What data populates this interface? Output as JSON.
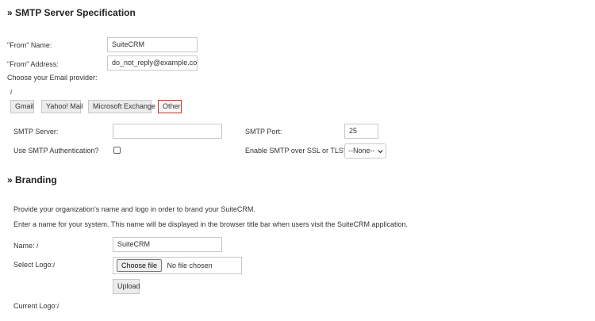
{
  "smtp": {
    "heading": "» SMTP Server Specification",
    "from_name_label": "\"From\" Name:",
    "from_name_value": "SuiteCRM",
    "from_address_label": "\"From\" Address:",
    "from_address_value": "do_not_reply@example.com",
    "provider_label": "Choose your Email provider:",
    "provider_info": "i",
    "providers": [
      "Gmail",
      "Yahoo! Mail",
      "Microsoft Exchange",
      "Other"
    ],
    "selected_provider": "Other",
    "server_label": "SMTP Server:",
    "server_value": "",
    "port_label": "SMTP Port:",
    "port_value": "25",
    "auth_label": "Use SMTP Authentication?",
    "ssl_label": "Enable SMTP over SSL or TLS?",
    "ssl_value": "--None--"
  },
  "branding": {
    "heading": "» Branding",
    "intro": "Provide your organization's name and logo in order to brand your SuiteCRM.",
    "desc": "Enter a name for your system. This name will be displayed in the browser title bar when users visit the SuiteCRM application.",
    "name_label": "Name:",
    "name_info": "i",
    "name_value": "SuiteCRM",
    "logo_label": "Select Logo:",
    "logo_info": "i",
    "choose_file_label": "Choose file",
    "no_file_text": "No file chosen",
    "upload_label": "Upload",
    "current_logo_label": "Current Logo:",
    "current_logo_info": "i"
  },
  "colors": {
    "selected_border": "#c0392b",
    "button_bg": "#ececec"
  }
}
